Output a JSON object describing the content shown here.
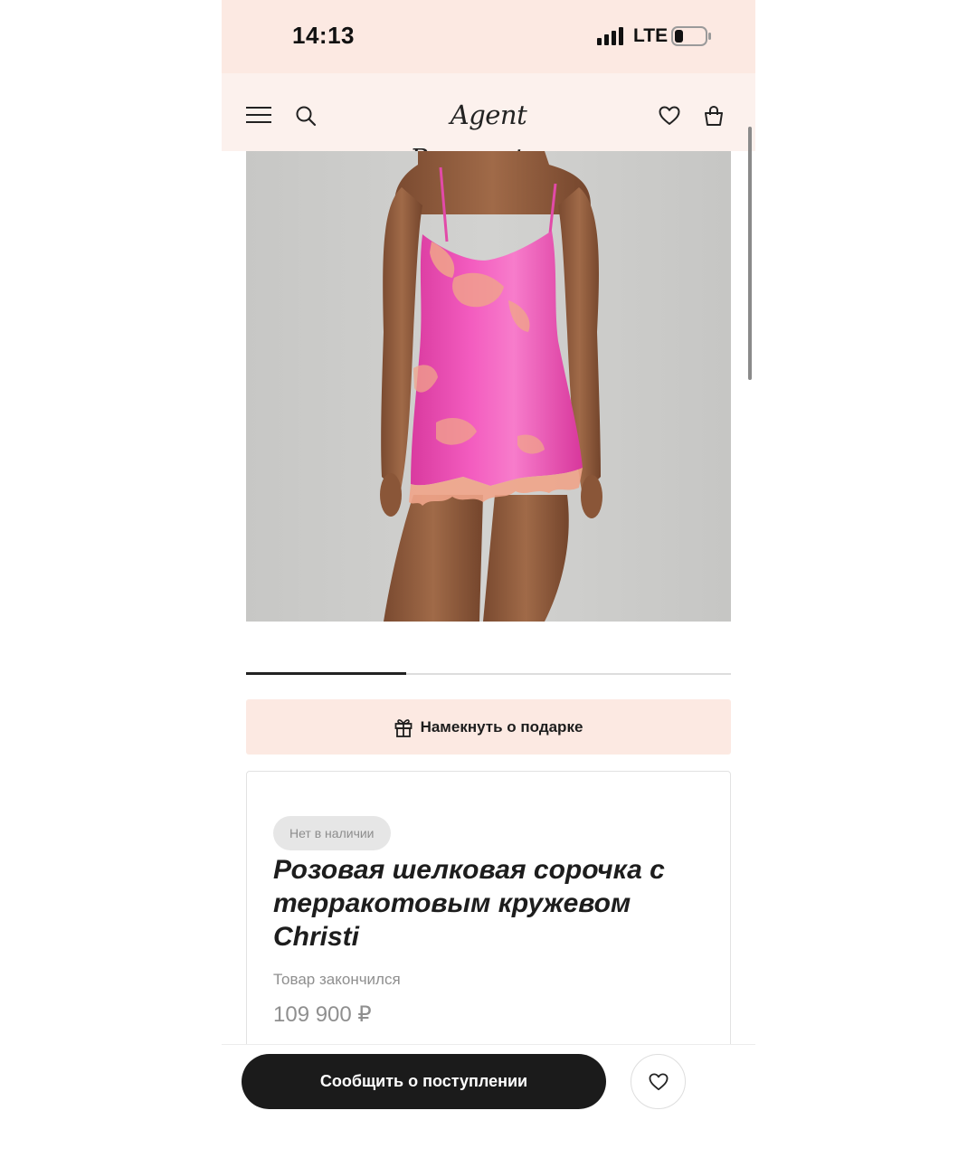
{
  "status_bar": {
    "time": "14:13",
    "network": "LTE",
    "icons": [
      "signal-bars-icon",
      "battery-icon"
    ]
  },
  "header": {
    "brand_logo": "Agent Provocateur",
    "icons": [
      "menu-icon",
      "search-icon",
      "heart-icon",
      "shopping-bag-icon"
    ]
  },
  "gallery": {
    "progress_fraction": 0.33
  },
  "gift_hint": {
    "icon": "gift-icon",
    "label": "Намекнуть о подарке"
  },
  "product": {
    "stock_badge": "Нет в наличии",
    "title": "Розовая шелковая сорочка с терракотовым кружевом Christi",
    "availability": "Товар закончился",
    "price": "109 900 ₽"
  },
  "bottom_bar": {
    "notify_label": "Сообщить о поступлении",
    "favorite_icon": "heart-icon"
  },
  "colors": {
    "header_bg": "#fcf1ed",
    "accent_pink_bg": "#fce9e2",
    "button_dark": "#1b1b1b",
    "garment_pink": "#f04fb4",
    "lace_terracotta": "#f0a48a"
  }
}
